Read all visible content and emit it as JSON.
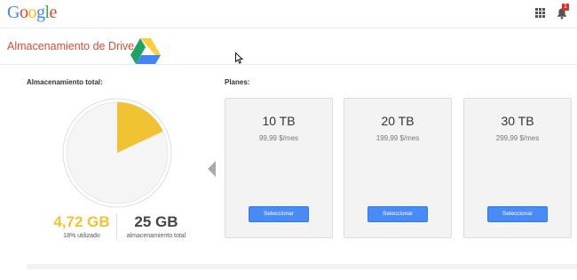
{
  "topbar": {
    "logo_letters": [
      {
        "ch": "G",
        "color": "#4285f4"
      },
      {
        "ch": "o",
        "color": "#ea4335"
      },
      {
        "ch": "o",
        "color": "#fbbc05"
      },
      {
        "ch": "g",
        "color": "#4285f4"
      },
      {
        "ch": "l",
        "color": "#34a853"
      },
      {
        "ch": "e",
        "color": "#ea4335"
      }
    ],
    "notification_count": "1",
    "icons": [
      "apps-grid-icon",
      "notification-bell-icon"
    ]
  },
  "header": {
    "title": "Almacenamiento de Drive",
    "title_color": "#dd4b39",
    "logo_icon": "google-drive-icon"
  },
  "storage": {
    "label": "Almacenamiento total:",
    "used": "4,72 GB",
    "used_caption": "18% utilizado",
    "total": "25 GB",
    "total_caption": "almacenamiento total",
    "used_fraction": 0.18,
    "used_color": "#f1c232"
  },
  "plans": {
    "label": "Planes:",
    "items": [
      {
        "size": "10 TB",
        "price": "99,99 $/mes",
        "button": "Seleccionar"
      },
      {
        "size": "20 TB",
        "price": "199,99 $/mes",
        "button": "Seleccionar"
      },
      {
        "size": "30 TB",
        "price": "299,99 $/mes",
        "button": "Seleccionar"
      }
    ],
    "prev_icon": "chevron-left-icon",
    "button_color": "#4a8af4"
  }
}
